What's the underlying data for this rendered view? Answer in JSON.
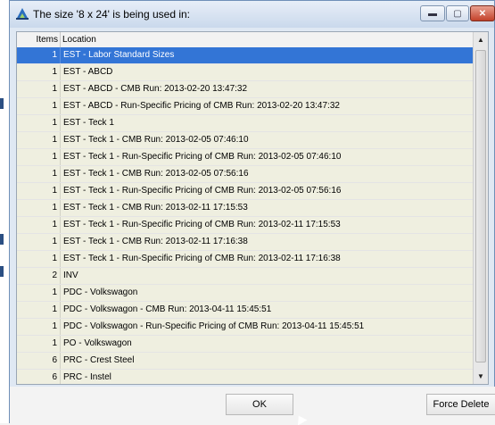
{
  "window": {
    "title": "The size '8 x 24' is being used in:",
    "controls": [
      "minimize-icon",
      "maximize-icon",
      "close-icon"
    ],
    "close_glyph": "✕",
    "minimize_glyph": "▬",
    "maximize_glyph": "▢"
  },
  "grid": {
    "headers": {
      "items": "Items",
      "location": "Location"
    },
    "rows": [
      {
        "items": "1",
        "location": "EST - Labor Standard Sizes",
        "selected": true
      },
      {
        "items": "1",
        "location": "EST - ABCD"
      },
      {
        "items": "1",
        "location": "EST - ABCD - CMB Run: 2013-02-20 13:47:32"
      },
      {
        "items": "1",
        "location": "EST - ABCD - Run-Specific Pricing of CMB Run: 2013-02-20 13:47:32"
      },
      {
        "items": "1",
        "location": "EST - Teck 1"
      },
      {
        "items": "1",
        "location": "EST - Teck 1 - CMB Run: 2013-02-05 07:46:10"
      },
      {
        "items": "1",
        "location": "EST - Teck 1 - Run-Specific Pricing of CMB Run: 2013-02-05 07:46:10"
      },
      {
        "items": "1",
        "location": "EST - Teck 1 - CMB Run: 2013-02-05 07:56:16"
      },
      {
        "items": "1",
        "location": "EST - Teck 1 - Run-Specific Pricing of CMB Run: 2013-02-05 07:56:16"
      },
      {
        "items": "1",
        "location": "EST - Teck 1 - CMB Run: 2013-02-11 17:15:53"
      },
      {
        "items": "1",
        "location": "EST - Teck 1 - Run-Specific Pricing of CMB Run: 2013-02-11 17:15:53"
      },
      {
        "items": "1",
        "location": "EST - Teck 1 - CMB Run: 2013-02-11 17:16:38"
      },
      {
        "items": "1",
        "location": "EST - Teck 1 - Run-Specific Pricing of CMB Run: 2013-02-11 17:16:38"
      },
      {
        "items": "2",
        "location": "INV"
      },
      {
        "items": "1",
        "location": "PDC - Volkswagon"
      },
      {
        "items": "1",
        "location": "PDC - Volkswagon - CMB Run: 2013-04-11 15:45:51"
      },
      {
        "items": "1",
        "location": "PDC - Volkswagon - Run-Specific Pricing of CMB Run: 2013-04-11 15:45:51"
      },
      {
        "items": "1",
        "location": "PO - Volkswagon"
      },
      {
        "items": "6",
        "location": "PRC - Crest Steel"
      },
      {
        "items": "6",
        "location": "PRC - Instel"
      }
    ]
  },
  "scrollbar": {
    "up_glyph": "▲",
    "down_glyph": "▼"
  },
  "footer": {
    "ok_label": "OK",
    "force_delete_label": "Force Delete"
  },
  "colors": {
    "selection": "#3375d6",
    "row_bg": "#efefe0",
    "close_button": "#c3422a"
  }
}
